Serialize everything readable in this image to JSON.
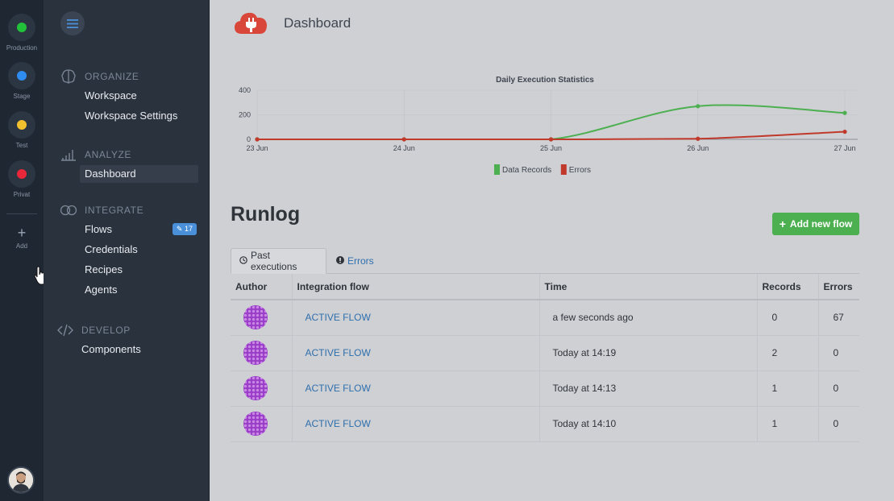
{
  "environments": [
    {
      "label": "Production",
      "color": "#22c13a"
    },
    {
      "label": "Stage",
      "color": "#2f8cf0"
    },
    {
      "label": "Test",
      "color": "#f2c12e"
    },
    {
      "label": "Privat",
      "color": "#e8283a"
    }
  ],
  "rail": {
    "add_label": "Add"
  },
  "nav": {
    "organize": {
      "title": "ORGANIZE",
      "items": [
        "Workspace",
        "Workspace Settings"
      ]
    },
    "analyze": {
      "title": "ANALYZE",
      "items": [
        "Dashboard"
      ]
    },
    "integrate": {
      "title": "INTEGRATE",
      "items": [
        "Flows",
        "Credentials",
        "Recipes",
        "Agents"
      ],
      "flows_badge": "17"
    },
    "develop": {
      "title": "DEVELOP",
      "items": [
        "Components"
      ]
    }
  },
  "header": {
    "title": "Dashboard"
  },
  "chart_data": {
    "type": "line",
    "title": "Daily Execution Statistics",
    "categories": [
      "23 Jun",
      "24 Jun",
      "25 Jun",
      "26 Jun",
      "27 Jun"
    ],
    "series": [
      {
        "name": "Data Records",
        "color": "#4caf50",
        "values": [
          0,
          0,
          0,
          270,
          215
        ]
      },
      {
        "name": "Errors",
        "color": "#c0392b",
        "values": [
          0,
          0,
          0,
          5,
          62
        ]
      }
    ],
    "ylim": [
      0,
      400
    ],
    "yticks": [
      0,
      200,
      400
    ],
    "grid": true,
    "legend": "bottom"
  },
  "runlog": {
    "title": "Runlog",
    "add_flow_label": "Add new flow",
    "tabs": {
      "past": "Past executions",
      "errors": "Errors"
    },
    "columns": [
      "Author",
      "Integration flow",
      "Time",
      "Records",
      "Errors"
    ],
    "rows": [
      {
        "flow": "ACTIVE FLOW",
        "time": "a few seconds ago",
        "records": "0",
        "errors": "67"
      },
      {
        "flow": "ACTIVE FLOW",
        "time": "Today at 14:19",
        "records": "2",
        "errors": "0"
      },
      {
        "flow": "ACTIVE FLOW",
        "time": "Today at 14:13",
        "records": "1",
        "errors": "0"
      },
      {
        "flow": "ACTIVE FLOW",
        "time": "Today at 14:10",
        "records": "1",
        "errors": "0"
      }
    ]
  }
}
